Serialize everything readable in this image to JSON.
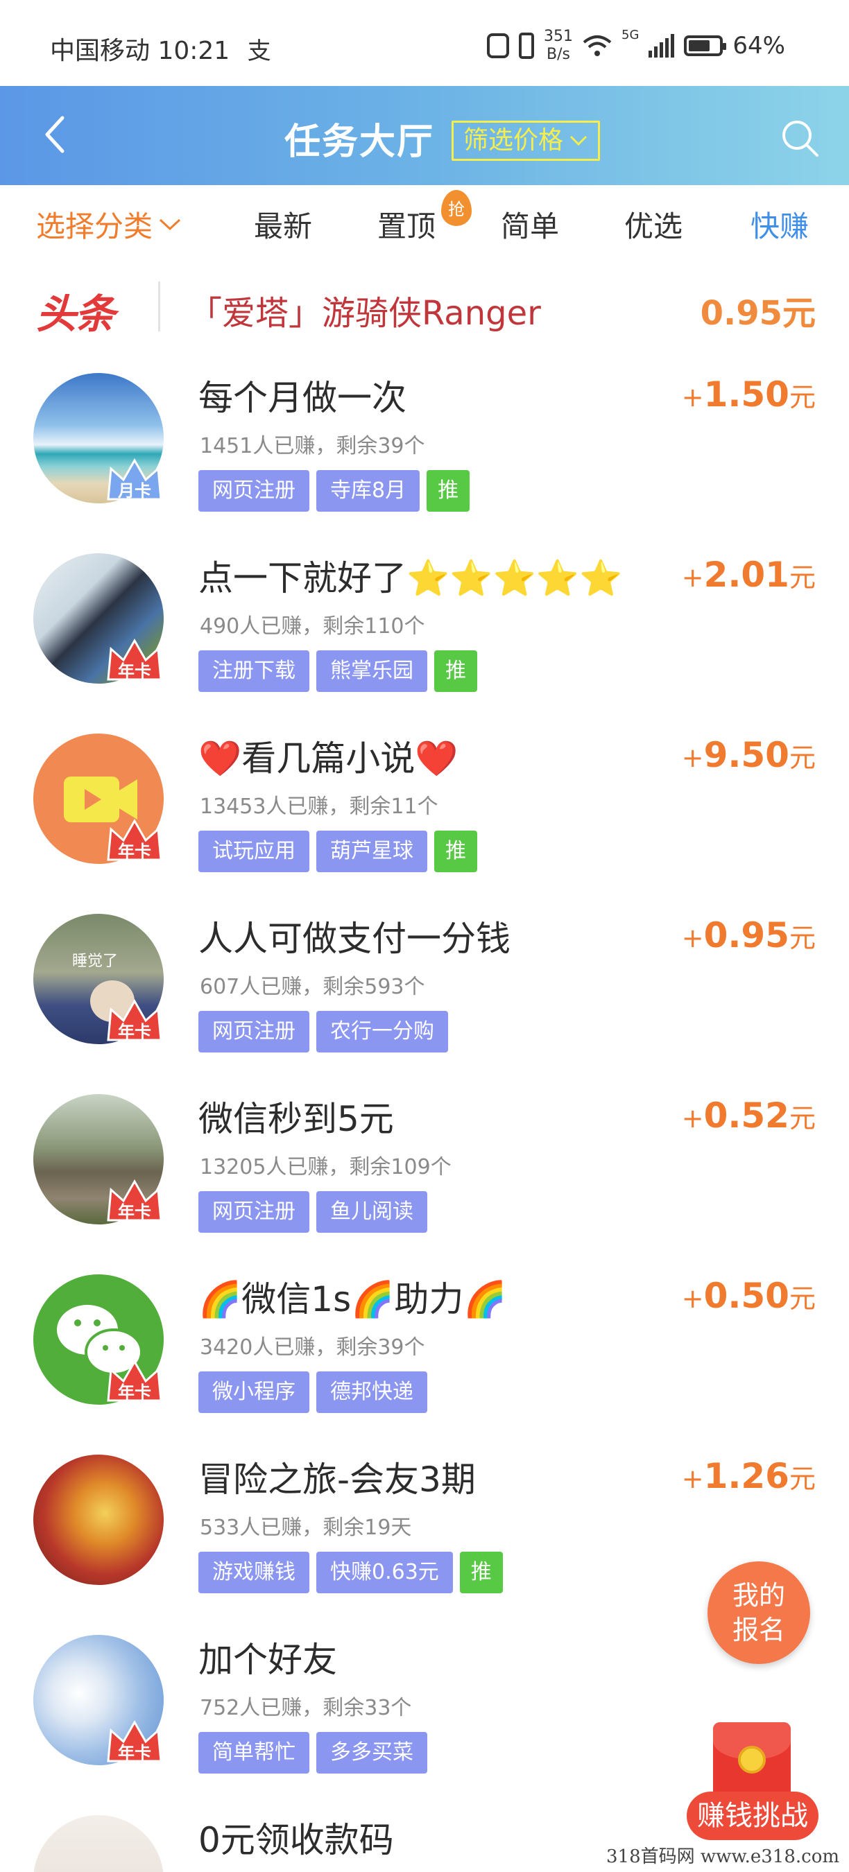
{
  "status_bar": {
    "carrier": "中国移动",
    "time": "10:21",
    "pay_icon_text": "支",
    "net_speed_value": "351",
    "net_speed_unit": "B/s",
    "network": "5G",
    "battery": "64%"
  },
  "header": {
    "title": "任务大厅",
    "filter_label": "筛选价格",
    "gradient": [
      "#5b97e6",
      "#8dd3e8"
    ]
  },
  "tabs": {
    "category_label": "选择分类",
    "items": [
      "最新",
      "置顶",
      "简单",
      "优选",
      "快赚"
    ],
    "hot_badge": "抢",
    "active": "快赚"
  },
  "headline": {
    "tag": "头条",
    "text": "「爱塔」游骑侠Ranger",
    "price": "0.95元"
  },
  "tasks": [
    {
      "title": "每个月做一次",
      "stats": "1451人已赚，剩余39个",
      "tags": [
        "网页注册",
        "寺库8月"
      ],
      "rec": "推",
      "price": "1.50",
      "badge": "月卡",
      "avatar": "beach"
    },
    {
      "title": "点一下就好了⭐⭐⭐⭐⭐",
      "stats": "490人已赚，剩余110个",
      "tags": [
        "注册下载",
        "熊掌乐园"
      ],
      "rec": "推",
      "price": "2.01",
      "badge": "年卡",
      "avatar": "man"
    },
    {
      "title": "❤️看几篇小说❤️",
      "stats": "13453人已赚，剩余11个",
      "tags": [
        "试玩应用",
        "葫芦星球"
      ],
      "rec": "推",
      "price": "9.50",
      "badge": "年卡",
      "avatar": "video"
    },
    {
      "title": "人人可做支付一分钱",
      "stats": "607人已赚，剩余593个",
      "tags": [
        "网页注册",
        "农行一分购"
      ],
      "rec": "",
      "price": "0.95",
      "badge": "年卡",
      "avatar": "cartoon",
      "avatar_text": "睡觉了"
    },
    {
      "title": "微信秒到5元",
      "stats": "13205人已赚，剩余109个",
      "tags": [
        "网页注册",
        "鱼儿阅读"
      ],
      "rec": "",
      "price": "0.52",
      "badge": "年卡",
      "avatar": "steps"
    },
    {
      "title": "🌈微信1s🌈助力🌈",
      "stats": "3420人已赚，剩余39个",
      "tags": [
        "微小程序",
        "德邦快递"
      ],
      "rec": "",
      "price": "0.50",
      "badge": "年卡",
      "avatar": "wechat"
    },
    {
      "title": "冒险之旅-会友3期",
      "stats": "533人已赚，剩余19天",
      "tags": [
        "游戏赚钱",
        "快赚0.63元"
      ],
      "rec": "推",
      "price": "1.26",
      "badge": "",
      "avatar": "game"
    },
    {
      "title": "加个好友",
      "stats": "752人已赚，剩余33个",
      "tags": [
        "简单帮忙",
        "多多买菜"
      ],
      "rec": "",
      "price": "",
      "badge": "年卡",
      "avatar": "sky"
    },
    {
      "title": "0元领收款码",
      "stats": "",
      "tags": [],
      "rec": "",
      "price": "",
      "badge": "",
      "avatar": "anime"
    }
  ],
  "price_plus": "+",
  "price_unit": "元",
  "floating": {
    "signup_line1": "我的",
    "signup_line2": "报名",
    "challenge_label": "赚钱挑战"
  },
  "watermark": "318首码网  www.e318.com",
  "colors": {
    "price": "#f07a2e",
    "tag": "#8b96f1",
    "rec_tag": "#58c944",
    "active_tab": "#3f8ee8",
    "headline_tag": "#e23a3a"
  }
}
